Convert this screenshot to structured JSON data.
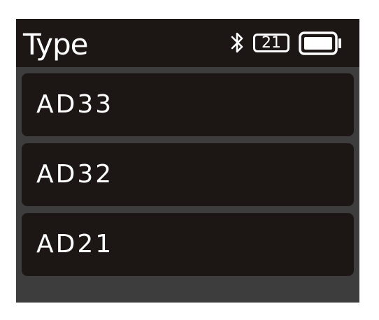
{
  "header": {
    "title": "Type",
    "channel": "21",
    "icons": [
      "bluetooth-icon",
      "battery-icon"
    ]
  },
  "list": {
    "items": [
      {
        "label": "AD33"
      },
      {
        "label": "AD32"
      },
      {
        "label": "AD21"
      }
    ]
  },
  "colors": {
    "background": "#3d3d3d",
    "item_background": "#1c1714",
    "text": "#ffffff"
  }
}
